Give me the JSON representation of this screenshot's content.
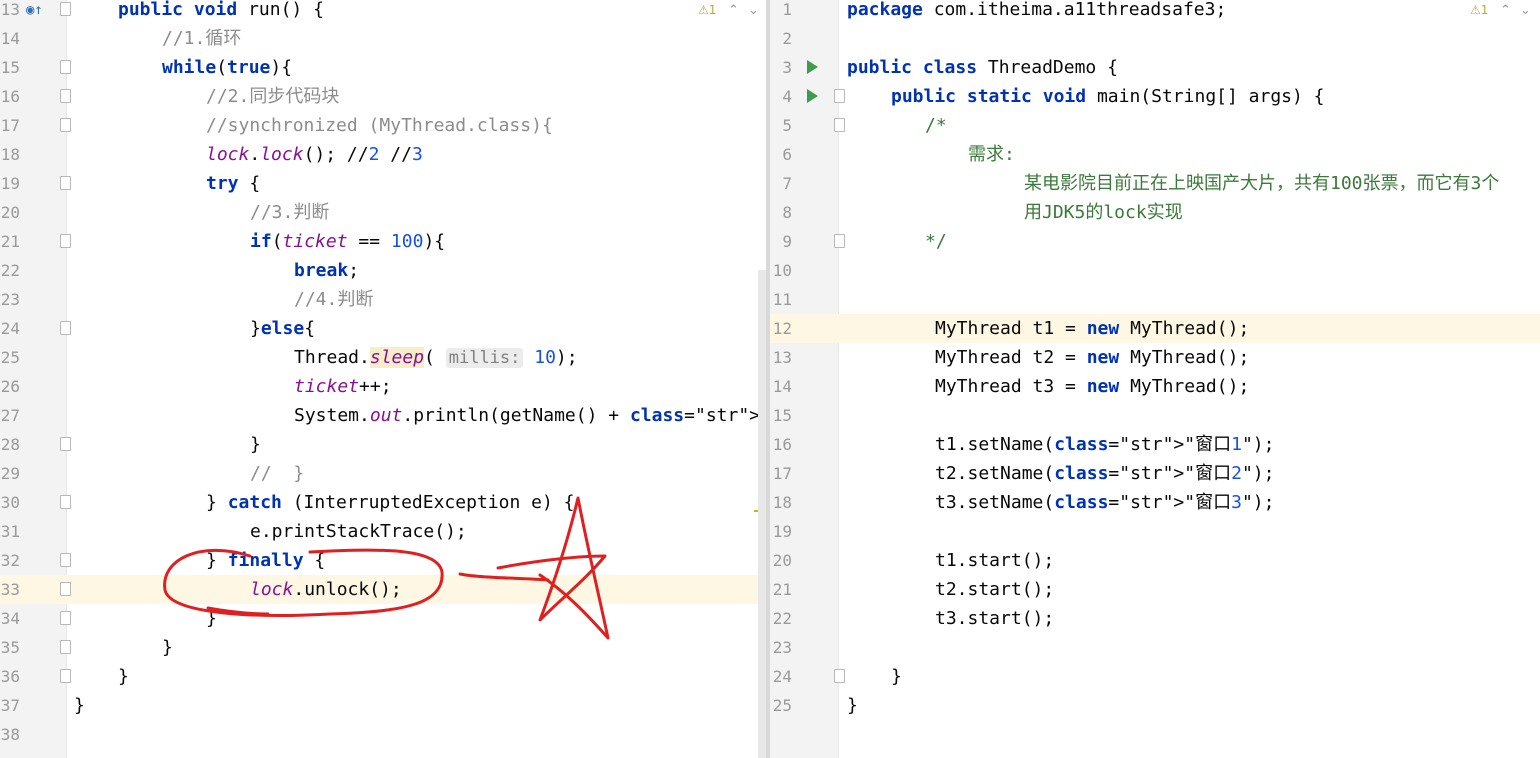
{
  "left_editor": {
    "warning": "⚠1",
    "param_hint": "millis:",
    "lines": [
      {
        "n": "13",
        "code": "public void run() {"
      },
      {
        "n": "14",
        "code": "//1.循环"
      },
      {
        "n": "15",
        "code": "while(true){"
      },
      {
        "n": "16",
        "code": "//2.同步代码块"
      },
      {
        "n": "17",
        "code": "//synchronized (MyThread.class){"
      },
      {
        "n": "18",
        "code": "lock.lock(); //2 //3"
      },
      {
        "n": "19",
        "code": "try {"
      },
      {
        "n": "20",
        "code": "//3.判断"
      },
      {
        "n": "21",
        "code": "if(ticket == 100){"
      },
      {
        "n": "22",
        "code": "break;"
      },
      {
        "n": "23",
        "code": "//4.判断"
      },
      {
        "n": "24",
        "code": "}else{"
      },
      {
        "n": "25",
        "code": "Thread.sleep( millis: 10);"
      },
      {
        "n": "26",
        "code": "ticket++;"
      },
      {
        "n": "27",
        "code": "System.out.println(getName() + \"在卖第\" + t"
      },
      {
        "n": "28",
        "code": "}"
      },
      {
        "n": "29",
        "code": "//  }"
      },
      {
        "n": "30",
        "code": "} catch (InterruptedException e) {"
      },
      {
        "n": "31",
        "code": "e.printStackTrace();"
      },
      {
        "n": "32",
        "code": "} finally {"
      },
      {
        "n": "33",
        "code": "lock.unlock();"
      },
      {
        "n": "34",
        "code": "}"
      },
      {
        "n": "35",
        "code": "}"
      },
      {
        "n": "36",
        "code": "}"
      },
      {
        "n": "37",
        "code": "}"
      },
      {
        "n": "38",
        "code": ""
      }
    ]
  },
  "right_editor": {
    "warning": "⚠1",
    "lines": [
      {
        "n": "1",
        "code": "package com.itheima.a11threadsafe3;"
      },
      {
        "n": "2",
        "code": ""
      },
      {
        "n": "3",
        "code": "public class ThreadDemo {"
      },
      {
        "n": "4",
        "code": "public static void main(String[] args) {"
      },
      {
        "n": "5",
        "code": "/*"
      },
      {
        "n": "6",
        "code": "需求:"
      },
      {
        "n": "7",
        "code": "某电影院目前正在上映国产大片，共有100张票，而它有3个"
      },
      {
        "n": "8",
        "code": "用JDK5的lock实现"
      },
      {
        "n": "9",
        "code": "*/"
      },
      {
        "n": "10",
        "code": ""
      },
      {
        "n": "11",
        "code": ""
      },
      {
        "n": "12",
        "code": "MyThread t1 = new MyThread();"
      },
      {
        "n": "13",
        "code": "MyThread t2 = new MyThread();"
      },
      {
        "n": "14",
        "code": "MyThread t3 = new MyThread();"
      },
      {
        "n": "15",
        "code": ""
      },
      {
        "n": "16",
        "code": "t1.setName(\"窗口1\");"
      },
      {
        "n": "17",
        "code": "t2.setName(\"窗口2\");"
      },
      {
        "n": "18",
        "code": "t3.setName(\"窗口3\");"
      },
      {
        "n": "19",
        "code": ""
      },
      {
        "n": "20",
        "code": "t1.start();"
      },
      {
        "n": "21",
        "code": "t2.start();"
      },
      {
        "n": "22",
        "code": "t3.start();"
      },
      {
        "n": "23",
        "code": ""
      },
      {
        "n": "24",
        "code": "}"
      },
      {
        "n": "25",
        "code": "}"
      }
    ]
  },
  "colors": {
    "keyword": "#0033b3",
    "comment": "#8c8c8c",
    "string": "#067d17",
    "number": "#1750eb",
    "field": "#871094",
    "annotation_pen": "#e02020",
    "current_line": "#fdf7e3"
  }
}
